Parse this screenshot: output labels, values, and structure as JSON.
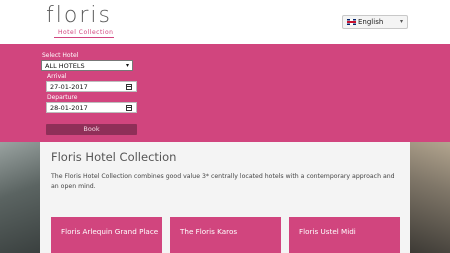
{
  "header": {
    "logo_word": "floris",
    "logo_sub": "Hotel Collection",
    "language": {
      "label": "English",
      "flag_icon": "uk-flag-icon"
    }
  },
  "booking": {
    "hotel_label": "Select Hotel",
    "hotel_value": "ALL HOTELS",
    "arrival_label": "Arrival",
    "arrival_value": "27-01-2017",
    "departure_label": "Departure",
    "departure_value": "28-01-2017",
    "book_label": "Book"
  },
  "main": {
    "title": "Floris Hotel Collection",
    "description": "The Floris Hotel Collection combines good value 3* centrally located hotels with a contemporary approach and an open mind."
  },
  "hotels": [
    {
      "name": "Floris Arlequin Grand Place"
    },
    {
      "name": "The Floris Karos"
    },
    {
      "name": "Floris Ustel Midi"
    }
  ],
  "colors": {
    "brand": "#d1457e",
    "button": "#8f2f58",
    "panel": "#f4f4f4"
  }
}
